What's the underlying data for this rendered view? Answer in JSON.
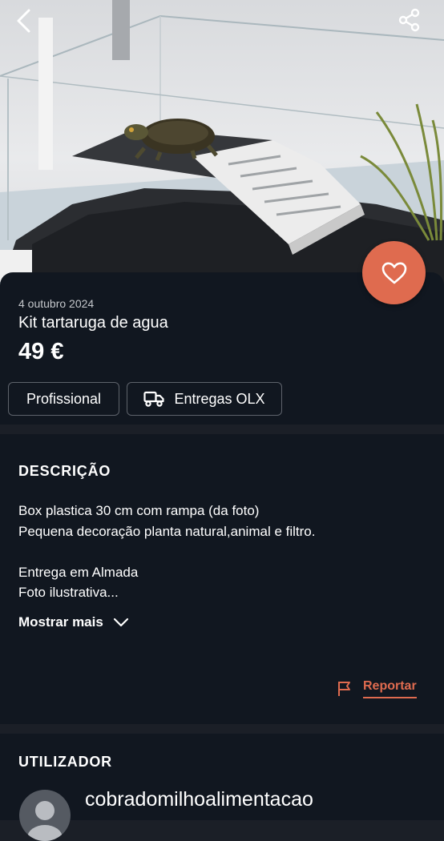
{
  "header": {
    "back_icon": "chevron-left-icon",
    "share_icon": "share-icon",
    "favorite_icon": "heart-outline-icon"
  },
  "listing": {
    "date": "4 outubro 2024",
    "title": "Kit tartaruga de agua",
    "price": "49 €",
    "tags": [
      "Profissional",
      "Entregas OLX"
    ]
  },
  "description": {
    "heading": "DESCRIÇÃO",
    "text": "Box plastica 30 cm com rampa (da foto)\nPequena decoração planta natural,animal e filtro.\n\nEntrega em Almada\nFoto ilustrativa...",
    "show_more": "Mostrar mais",
    "report": "Reportar"
  },
  "user": {
    "heading": "UTILIZADOR",
    "name": "cobradomilhoalimentacao"
  },
  "colors": {
    "accent": "#df6b4f",
    "background": "#111720",
    "divider": "#1b1f27"
  }
}
